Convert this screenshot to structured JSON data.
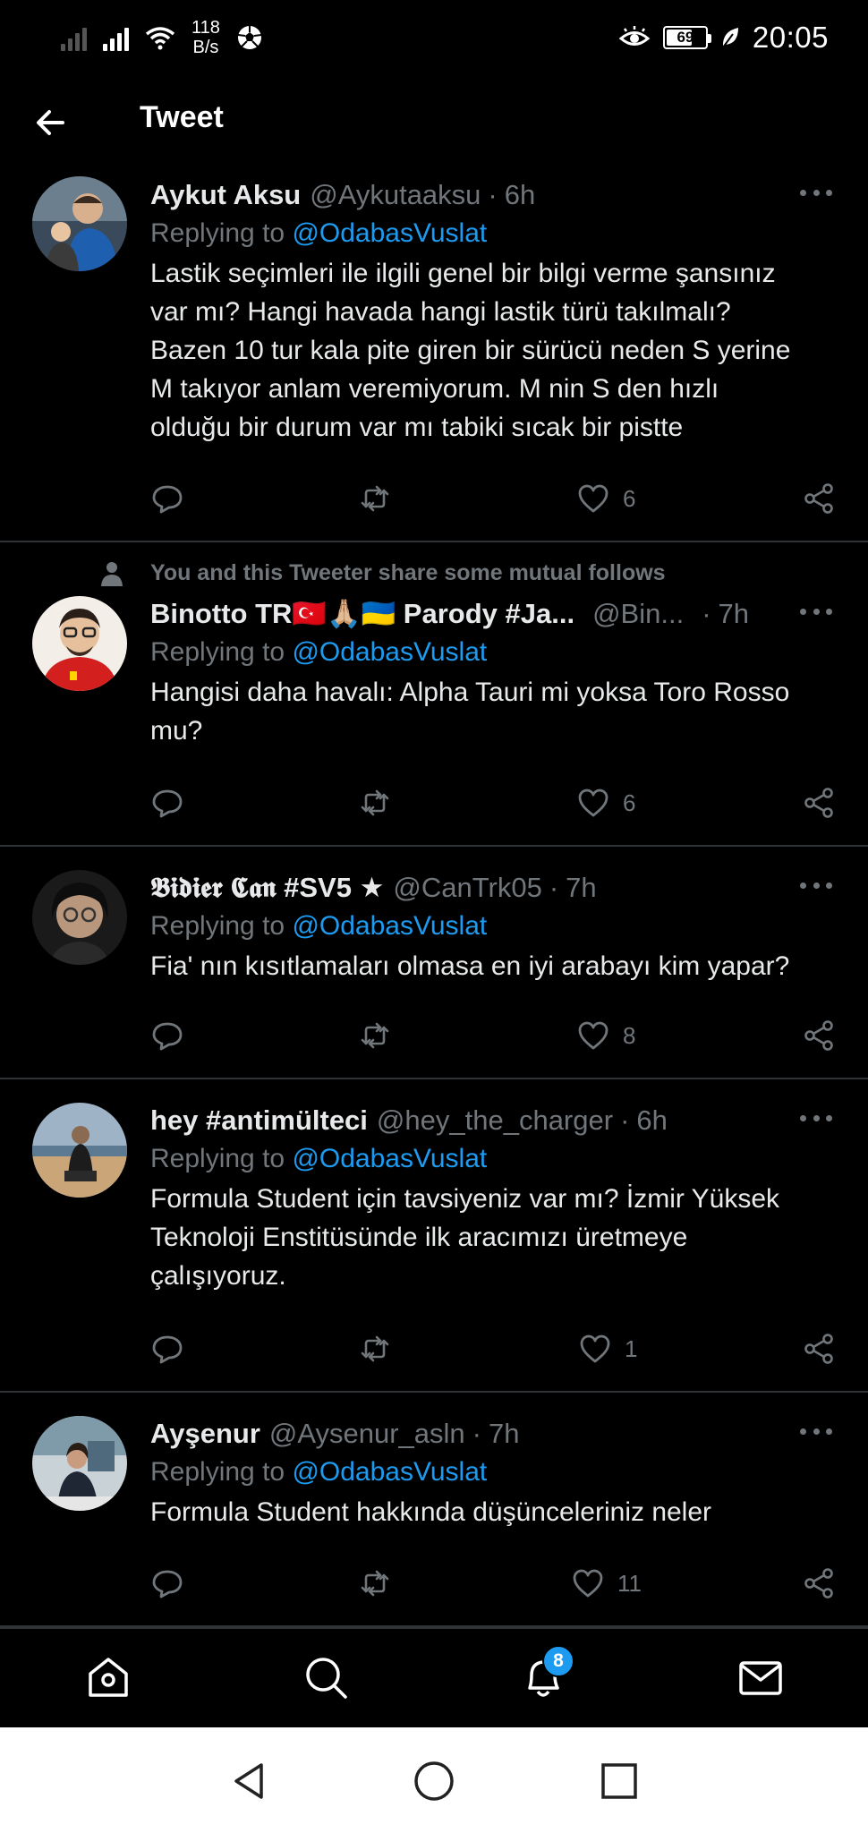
{
  "status_bar": {
    "net_speed_value": "118",
    "net_speed_unit": "B/s",
    "battery": "69",
    "time": "20:05"
  },
  "header": {
    "title": "Tweet"
  },
  "replying_prefix": "Replying to",
  "tweets": [
    {
      "name": "Aykut Aksu",
      "handle": "@Aykutaaksu",
      "time": "6h",
      "replying_to": "@OdabasVuslat",
      "text_lines": [
        "Lastik seçimleri ile ilgili genel bir bilgi verme şansınız",
        "var mı? Hangi havada hangi lastik türü takılmalı?",
        "Bazen 10 tur kala pite giren bir sürücü neden S yerine",
        "M takıyor anlam veremiyorum. M nin S den hızlı",
        "olduğu bir durum var mı tabiki sıcak bir pistte"
      ],
      "likes": "6"
    },
    {
      "mutual_note": "You and this Tweeter share some mutual follows",
      "name": "Binotto TR🇹🇷🙏🏼🇺🇦 Parody #Ja...",
      "handle": "@Bin...",
      "time": "7h",
      "replying_to": "@OdabasVuslat",
      "text_lines": [
        "Hangisi daha havalı: Alpha Tauri mi yoksa Toro Rosso",
        "mu?"
      ],
      "likes": "6"
    },
    {
      "name": "𝕭𝖎𝖉𝖎𝖊𝖗 𝕮𝖆𝖓 #SV5 ★",
      "handle": "@CanTrk05",
      "time": "7h",
      "replying_to": "@OdabasVuslat",
      "text_lines": [
        "Fia' nın kısıtlamaları olmasa en iyi arabayı kim yapar?"
      ],
      "likes": "8"
    },
    {
      "name": "hey #antimülteci",
      "handle": "@hey_the_charger",
      "time": "6h",
      "replying_to": "@OdabasVuslat",
      "text_lines": [
        "Formula Student için tavsiyeniz var mı? İzmir Yüksek",
        "Teknoloji Enstitüsünde ilk aracımızı üretmeye",
        "çalışıyoruz."
      ],
      "likes": "1"
    },
    {
      "name": "Ayşenur",
      "handle": "@Aysenur_asln",
      "time": "7h",
      "replying_to": "@OdabasVuslat",
      "text_lines": [
        "Formula Student hakkında düşünceleriniz neler"
      ],
      "likes": "11"
    }
  ],
  "bottom_nav": {
    "notifications_badge": "8"
  },
  "colors": {
    "accent": "#1d9bf0",
    "muted": "#71767b",
    "divider": "#2f3336"
  }
}
